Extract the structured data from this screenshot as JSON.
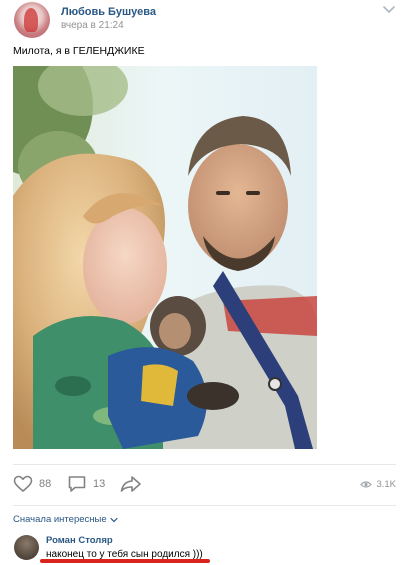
{
  "post": {
    "author": "Любовь Бушуева",
    "time": "вчера в 21:24",
    "text": "Милота, я в ГЕЛЕНДЖИКЕ"
  },
  "actions": {
    "likes": "88",
    "comments": "13",
    "views": "3.1K"
  },
  "comments_section": {
    "sort_label": "Сначала интересные",
    "items": [
      {
        "author": "Роман Столяр",
        "text": "наконец то у тебя сын родился )))"
      }
    ]
  },
  "colors": {
    "link": "#2a5885",
    "meta": "#939393",
    "icon": "#828282",
    "divider": "#e7e8ec",
    "underline_annotation": "#d9231f"
  }
}
